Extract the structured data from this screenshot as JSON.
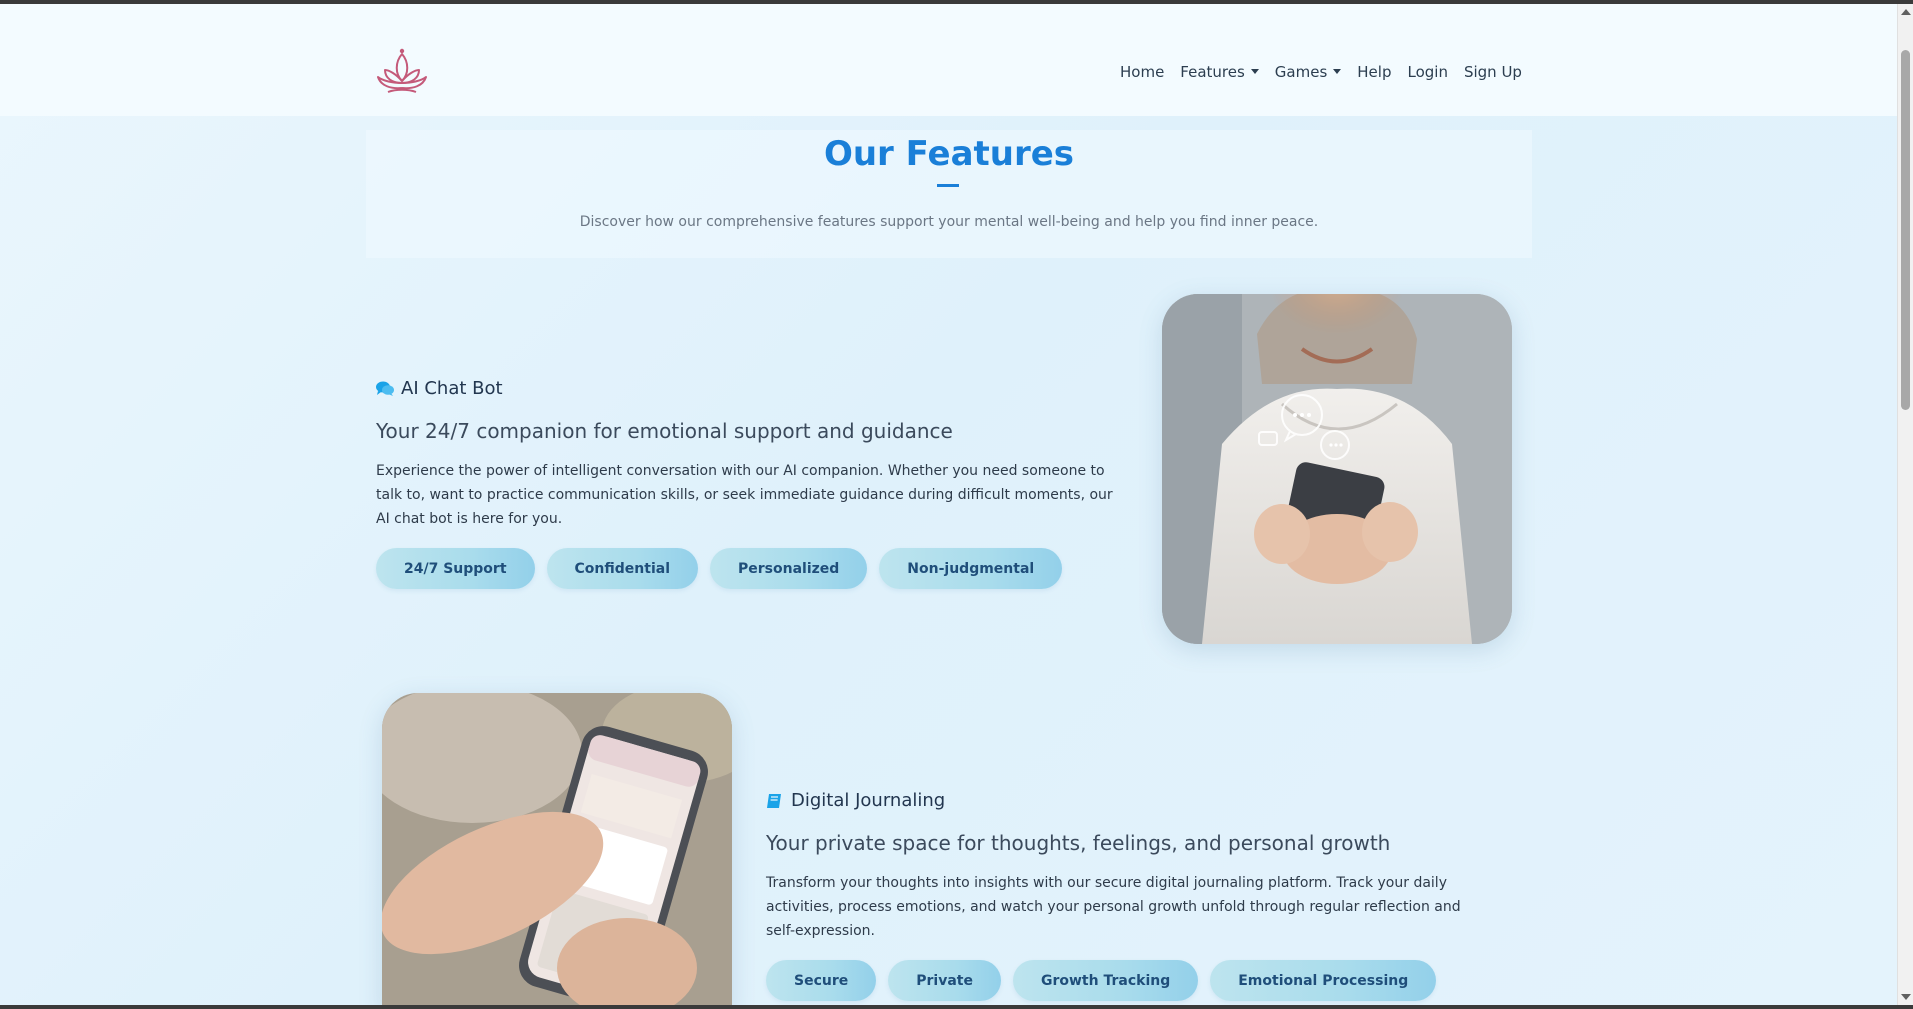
{
  "nav": {
    "items": [
      {
        "label": "Home",
        "dropdown": false
      },
      {
        "label": "Features",
        "dropdown": true
      },
      {
        "label": "Games",
        "dropdown": true
      },
      {
        "label": "Help",
        "dropdown": false
      },
      {
        "label": "Login",
        "dropdown": false
      },
      {
        "label": "Sign Up",
        "dropdown": false
      }
    ],
    "logo_icon": "lotus-icon"
  },
  "header": {
    "title": "Our Features",
    "subtitle": "Discover how our comprehensive features support your mental well-being and help you find inner peace."
  },
  "features": [
    {
      "title": "AI Chat Bot",
      "icon": "chat-bubbles-icon",
      "tagline": "Your 24/7 companion for emotional support and guidance",
      "description": "Experience the power of intelligent conversation with our AI companion. Whether you need someone to talk to, want to practice communication skills, or seek immediate guidance during difficult moments, our AI chat bot is here for you.",
      "tags": [
        "24/7 Support",
        "Confidential",
        "Personalized",
        "Non-judgmental"
      ],
      "image": "woman-using-phone-chat-photo"
    },
    {
      "title": "Digital Journaling",
      "icon": "journal-book-icon",
      "tagline": "Your private space for thoughts, feelings, and personal growth",
      "description": "Transform your thoughts into insights with our secure digital journaling platform. Track your daily activities, process emotions, and watch your personal growth unfold through regular reflection and self-expression.",
      "tags": [
        "Secure",
        "Private",
        "Growth Tracking",
        "Emotional Processing"
      ],
      "image": "phone-daily-journal-photo"
    }
  ],
  "colors": {
    "accent": "#1a7fd8",
    "logo": "#c45a7a",
    "chat_icon": "#1aa3e8",
    "pill_text": "#1f4e7a",
    "background": "#e4f3fc"
  }
}
